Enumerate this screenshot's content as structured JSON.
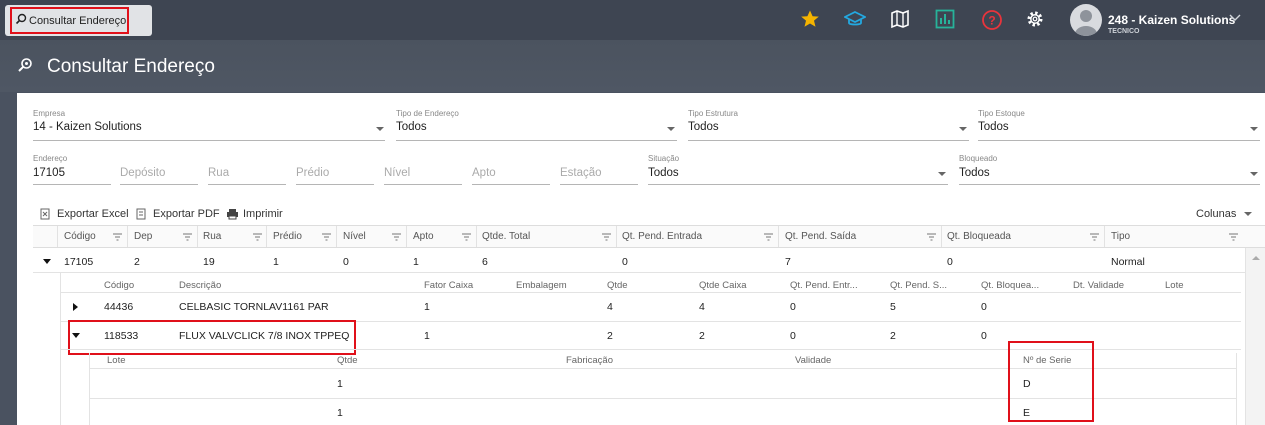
{
  "tab": {
    "label": "Consultar Endereço"
  },
  "topbar": {
    "icons": [
      "star-icon",
      "graduation-cap-icon",
      "map-icon",
      "chart-icon",
      "help-icon",
      "gear-icon"
    ],
    "accent_star": "#f5b400",
    "accent_cap": "#23a8e0",
    "accent_chart": "#27b39a",
    "accent_help": "#e8343c",
    "user": {
      "name": "248 - Kaizen Solutions",
      "role": "TECNICO"
    }
  },
  "page": {
    "title": "Consultar Endereço"
  },
  "filters": {
    "empresa": {
      "label": "Empresa",
      "value": "14 - Kaizen Solutions"
    },
    "tipo_endereco": {
      "label": "Tipo de Endereço",
      "value": "Todos"
    },
    "tipo_estrutura": {
      "label": "Tipo Estrutura",
      "value": "Todos"
    },
    "tipo_estoque": {
      "label": "Tipo Estoque",
      "value": "Todos"
    },
    "endereco": {
      "label": "Endereço",
      "value": "17105"
    },
    "deposito": {
      "placeholder": "Depósito"
    },
    "rua": {
      "placeholder": "Rua"
    },
    "predio": {
      "placeholder": "Prédio"
    },
    "nivel": {
      "placeholder": "Nível"
    },
    "apto": {
      "placeholder": "Apto"
    },
    "estacao": {
      "placeholder": "Estação"
    },
    "situacao": {
      "label": "Situação",
      "value": "Todos"
    },
    "bloqueado": {
      "label": "Bloqueado",
      "value": "Todos"
    }
  },
  "toolbar": {
    "export_excel": "Exportar Excel",
    "export_pdf": "Exportar PDF",
    "print": "Imprimir",
    "columns": "Colunas"
  },
  "grid": {
    "headers": [
      "Código",
      "Dep",
      "Rua",
      "Prédio",
      "Nível",
      "Apto",
      "Qtde. Total",
      "Qt. Pend. Entrada",
      "Qt. Pend. Saída",
      "Qt. Bloqueada",
      "Tipo"
    ],
    "row": {
      "codigo": "17105",
      "dep": "2",
      "rua": "19",
      "predio": "1",
      "nivel": "0",
      "apto": "1",
      "qtde_total": "6",
      "pend_entrada": "0",
      "pend_saida": "7",
      "bloqueada": "0",
      "tipo": "Normal"
    }
  },
  "subgrid": {
    "headers": [
      "Código",
      "Descrição",
      "Fator Caixa",
      "Embalagem",
      "Qtde",
      "Qtde Caixa",
      "Qt. Pend. Entr...",
      "Qt. Pend. S...",
      "Qt. Bloquea...",
      "Dt. Validade",
      "Lote"
    ],
    "rows": [
      {
        "codigo": "44436",
        "descricao": "CELBASIC TORNLAV1161 PAR",
        "fator": "1",
        "qtde": "4",
        "qtde_caixa": "4",
        "pend_entr": "0",
        "pend_saida": "5",
        "bloqueada": "0"
      },
      {
        "codigo": "118533",
        "descricao": "FLUX VALVCLICK 7/8 INOX TPPEQ",
        "fator": "1",
        "qtde": "2",
        "qtde_caixa": "2",
        "pend_entr": "0",
        "pend_saida": "2",
        "bloqueada": "0"
      }
    ]
  },
  "lotgrid": {
    "headers": [
      "Lote",
      "Qtde",
      "Fabricação",
      "Validade",
      "Nº de Serie"
    ],
    "rows": [
      {
        "qtde": "1",
        "serie": "D"
      },
      {
        "qtde": "1",
        "serie": "E"
      }
    ]
  }
}
